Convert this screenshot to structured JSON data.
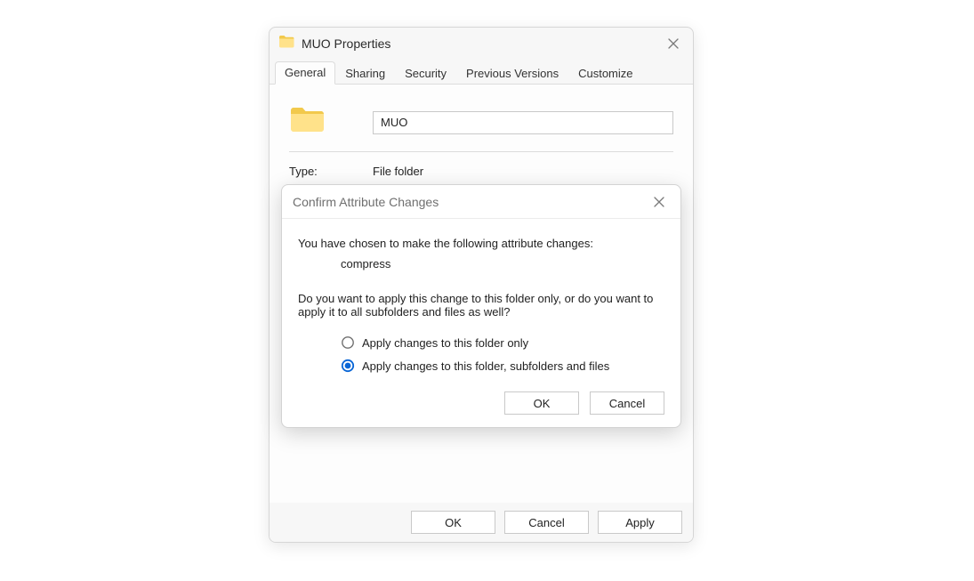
{
  "properties": {
    "title": "MUO Properties",
    "tabs": [
      "General",
      "Sharing",
      "Security",
      "Previous Versions",
      "Customize"
    ],
    "active_tab_index": 0,
    "folder_name": "MUO",
    "type_label": "Type:",
    "type_value": "File folder",
    "buttons": {
      "ok": "OK",
      "cancel": "Cancel",
      "apply": "Apply"
    }
  },
  "confirm": {
    "title": "Confirm Attribute Changes",
    "intro": "You have chosen to make the following attribute changes:",
    "change": "compress",
    "question": "Do you want to apply this change to this folder only, or do you want to apply it to all subfolders and files as well?",
    "option_this_only": "Apply changes to this folder only",
    "option_recursive": "Apply changes to this folder, subfolders and files",
    "selected_option": 1,
    "buttons": {
      "ok": "OK",
      "cancel": "Cancel"
    }
  },
  "colors": {
    "accent": "#0a66d6"
  }
}
